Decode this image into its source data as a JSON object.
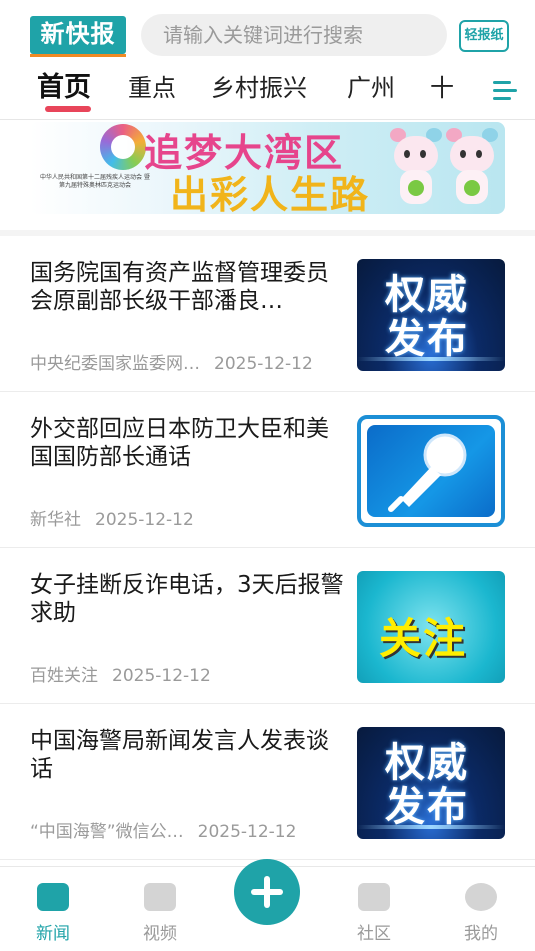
{
  "header": {
    "logo_text": "新快报",
    "search_placeholder": "请输入关键词进行搜索",
    "paper_button": "轻报纸"
  },
  "tabs": [
    {
      "label": "首页",
      "active": true
    },
    {
      "label": "重点",
      "active": false
    },
    {
      "label": "乡村振兴",
      "active": false
    },
    {
      "label": "广州",
      "active": false
    },
    {
      "label": "十",
      "active": false
    }
  ],
  "banner": {
    "line1": "追梦大湾区",
    "line2": "出彩人生路",
    "small_text": "中华人民共和国第十二届残疾人运动会 暨第九届特殊奥林匹克运动会"
  },
  "news": [
    {
      "title": "国务院国有资产监督管理委员会原副部长级干部潘良…",
      "source": "中央纪委国家监委网…",
      "date": "2025-12-12",
      "thumb": "权威发布"
    },
    {
      "title": "外交部回应日本防卫大臣和美国国防部长通话",
      "source": "新华社",
      "date": "2025-12-12",
      "thumb": ""
    },
    {
      "title": "女子挂断反诈电话，3天后报警求助",
      "source": "百姓关注",
      "date": "2025-12-12",
      "thumb": "关注"
    },
    {
      "title": "中国海警局新闻发言人发表谈话",
      "source": "“中国海警”微信公…",
      "date": "2025-12-12",
      "thumb": "权威发布"
    }
  ],
  "bottom_nav": [
    {
      "label": "新闻",
      "icon": "news-icon",
      "active": true
    },
    {
      "label": "视频",
      "icon": "video-icon",
      "active": false
    },
    {
      "label": "社区",
      "icon": "community-icon",
      "active": false
    },
    {
      "label": "我的",
      "icon": "profile-icon",
      "active": false
    }
  ],
  "colors": {
    "brand": "#1fa3a8",
    "tab_underline": "#e8455a",
    "accent_logo": "#f08a24"
  }
}
